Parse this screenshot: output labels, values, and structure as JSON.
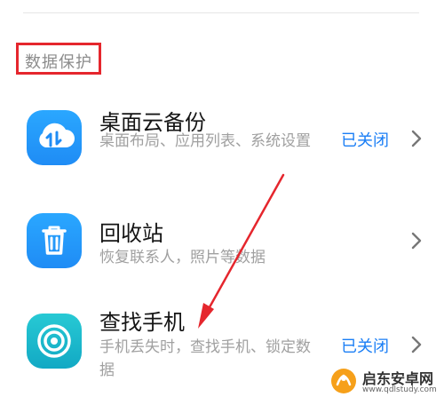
{
  "section": {
    "title": "数据保护"
  },
  "items": [
    {
      "title": "桌面云备份",
      "description": "桌面布局、应用列表、系统设置",
      "status": "已关闭",
      "icon": "cloud-sync-icon"
    },
    {
      "title": "回收站",
      "description": "恢复联系人，照片等数据",
      "status": "",
      "icon": "trash-icon"
    },
    {
      "title": "查找手机",
      "description": "手机丢失时，查找手机、锁定数据",
      "status": "已关闭",
      "icon": "find-phone-icon"
    }
  ],
  "watermark": {
    "title": "启东安卓网",
    "url": "www.qdlstudy.com"
  },
  "colors": {
    "accent": "#1a7ef5",
    "highlight": "#e5262d",
    "icon_blue": "#2196f3",
    "find_phone_teal": "#18b7c8"
  }
}
